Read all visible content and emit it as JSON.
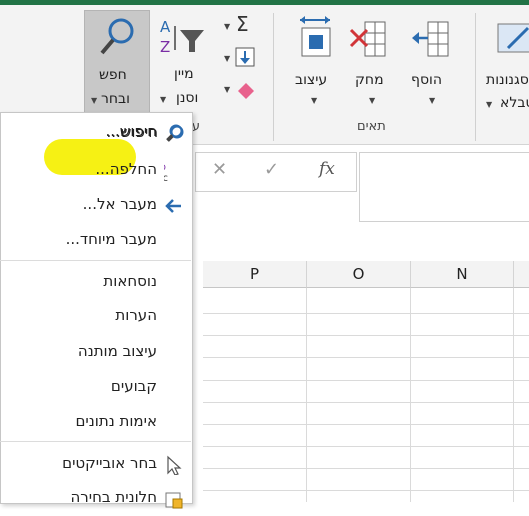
{
  "ribbon": {
    "find_select": {
      "line1": "חפש",
      "line2": "ובחר"
    },
    "sort_filter": {
      "line1": "מיין",
      "line2": "וסנן"
    },
    "format": {
      "label": "עיצוב"
    },
    "delete": {
      "label": "מחק"
    },
    "insert": {
      "label": "הוסף"
    },
    "styles": {
      "line1": "סגנונות",
      "line2": "טבלא"
    },
    "cells_group_label": "תאים",
    "editing_group_label": "עריכה"
  },
  "formula_bar": {
    "fx": "fx",
    "cancel": "✕",
    "enter": "✓"
  },
  "columns": [
    "P",
    "O",
    "N"
  ],
  "menu": {
    "items": [
      {
        "label": "חיפוש...",
        "icon": "search-icon"
      },
      {
        "label": "החלפה...",
        "icon": "replace-icon"
      },
      {
        "label": "מעבר אל...",
        "icon": "goto-arrow-icon"
      },
      {
        "label": "מעבר מיוחד..."
      },
      {
        "label": "נוסחאות"
      },
      {
        "label": "הערות"
      },
      {
        "label": "עיצוב מותנה"
      },
      {
        "label": "קבועים"
      },
      {
        "label": "אימות נתונים"
      },
      {
        "label": "בחר אובייקטים",
        "icon": "pointer-icon"
      },
      {
        "label": "חלונית בחירה",
        "icon": "selection-pane-icon"
      }
    ]
  },
  "colors": {
    "accent": "#217346",
    "highlight": "#f5f000"
  }
}
